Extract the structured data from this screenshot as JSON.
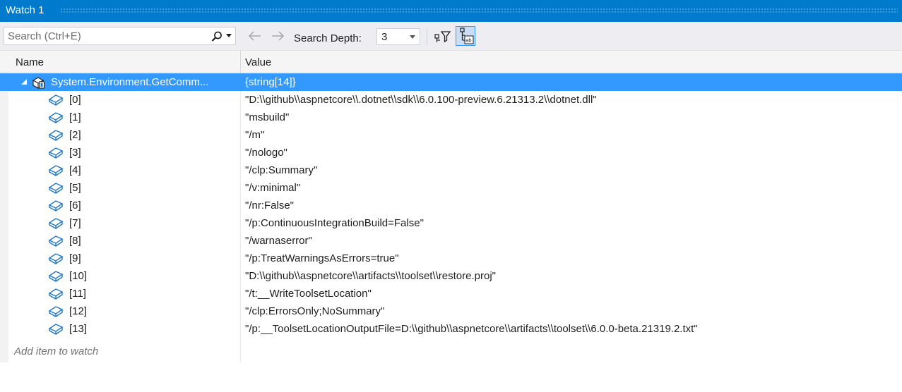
{
  "window": {
    "title": "Watch 1"
  },
  "toolbar": {
    "search_placeholder": "Search (Ctrl+E)",
    "depth_label": "Search Depth:",
    "depth_value": "3"
  },
  "columns": {
    "name": "Name",
    "value": "Value"
  },
  "root": {
    "name": "System.Environment.GetComm...",
    "value": "{string[14]}"
  },
  "items": [
    {
      "name": "[0]",
      "value": "\"D:\\\\github\\\\aspnetcore\\\\.dotnet\\\\sdk\\\\6.0.100-preview.6.21313.2\\\\dotnet.dll\""
    },
    {
      "name": "[1]",
      "value": "\"msbuild\""
    },
    {
      "name": "[2]",
      "value": "\"/m\""
    },
    {
      "name": "[3]",
      "value": "\"/nologo\""
    },
    {
      "name": "[4]",
      "value": "\"/clp:Summary\""
    },
    {
      "name": "[5]",
      "value": "\"/v:minimal\""
    },
    {
      "name": "[6]",
      "value": "\"/nr:False\""
    },
    {
      "name": "[7]",
      "value": "\"/p:ContinuousIntegrationBuild=False\""
    },
    {
      "name": "[8]",
      "value": "\"/warnaserror\""
    },
    {
      "name": "[9]",
      "value": "\"/p:TreatWarningsAsErrors=true\""
    },
    {
      "name": "[10]",
      "value": "\"D:\\\\github\\\\aspnetcore\\\\artifacts\\\\toolset\\\\restore.proj\""
    },
    {
      "name": "[11]",
      "value": "\"/t:__WriteToolsetLocation\""
    },
    {
      "name": "[12]",
      "value": "\"/clp:ErrorsOnly;NoSummary\""
    },
    {
      "name": "[13]",
      "value": "\"/p:__ToolsetLocationOutputFile=D:\\\\github\\\\aspnetcore\\\\artifacts\\\\toolset\\\\6.0.0-beta.21319.2.txt\""
    }
  ],
  "add_item": "Add item to watch",
  "colors": {
    "titlebar": "#007acc",
    "selection": "#3399ff",
    "icon_blue": "#1e76c8"
  },
  "icons": [
    "search-icon",
    "arrow-left-icon",
    "arrow-right-icon",
    "filter-icon",
    "hex-display-icon",
    "expand-triangle-icon",
    "object-icon",
    "field-icon"
  ]
}
